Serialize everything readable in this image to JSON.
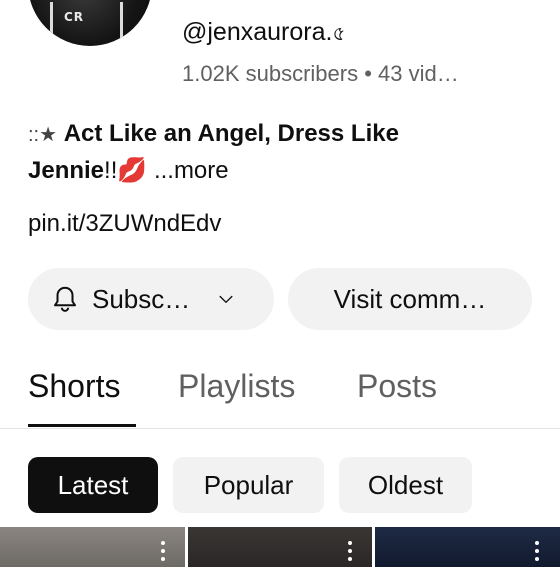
{
  "channel": {
    "handle": "@jenxaurora.",
    "handle_mark": "৫",
    "stats": "1.02K subscribers • 43 vid…",
    "avatar_text": "CR"
  },
  "bio": {
    "prefix": "::★",
    "bold_1": "Act Like an Angel, Dress Like",
    "bold_2": "Jennie",
    "after_name": "!!",
    "emoji": "💋",
    "more": "...more"
  },
  "link": "pin.it/3ZUWndEdv",
  "actions": {
    "subscribe_label": "Subsc…",
    "visit_label": "Visit comm…"
  },
  "tabs": [
    {
      "label": "Shorts",
      "active": true
    },
    {
      "label": "Playlists",
      "active": false
    },
    {
      "label": "Posts",
      "active": false
    }
  ],
  "filters": [
    {
      "label": "Latest",
      "selected": true
    },
    {
      "label": "Popular",
      "selected": false
    },
    {
      "label": "Oldest",
      "selected": false
    }
  ],
  "colors": {
    "text": "#0f0f0f",
    "secondary": "#606060",
    "pill_bg": "#f2f2f2",
    "selected_chip": "#0f0f0f"
  }
}
